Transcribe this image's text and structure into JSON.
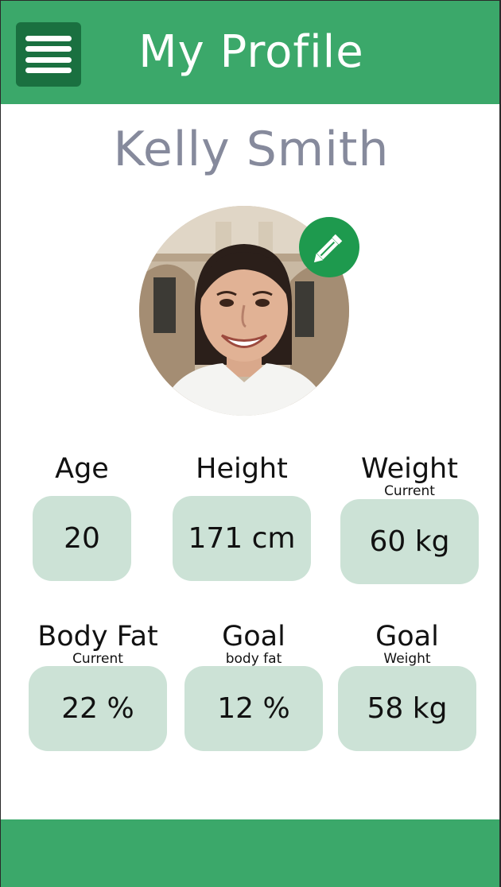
{
  "header": {
    "title": "My Profile"
  },
  "profile": {
    "name": "Kelly Smith"
  },
  "stats": {
    "age": {
      "label": "Age",
      "value": "20"
    },
    "height": {
      "label": "Height",
      "value": "171 cm"
    },
    "weight": {
      "label": "Weight",
      "sublabel": "Current",
      "value": "60 kg"
    },
    "body_fat": {
      "label": "Body Fat",
      "sublabel": "Current",
      "value": "22 %"
    },
    "goal_body_fat": {
      "label": "Goal",
      "sublabel": "body fat",
      "value": "12 %"
    },
    "goal_weight": {
      "label": "Goal",
      "sublabel": "Weight",
      "value": "58 kg"
    }
  },
  "icons": {
    "menu": "hamburger-menu-icon",
    "edit": "pencil-icon"
  },
  "colors": {
    "brand_green": "#3ba86a",
    "menu_button": "#1a7040",
    "edit_button": "#1e9a4e",
    "value_box": "#cce2d6",
    "name_text": "#868a9c"
  }
}
